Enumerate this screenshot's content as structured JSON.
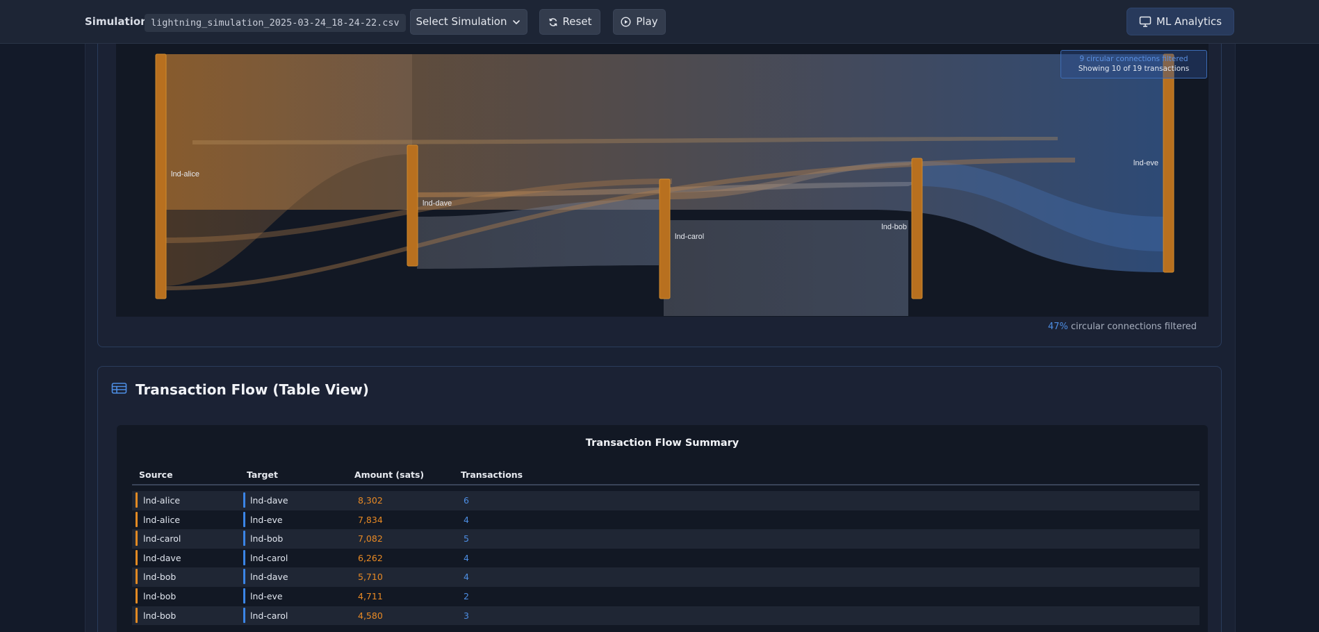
{
  "header": {
    "simulation_label": "Simulation:",
    "simulation_file": "lightning_simulation_2025-03-24_18-24-22.csv",
    "select_label": "Select Simulation",
    "reset_label": "Reset",
    "play_label": "Play",
    "ml_label": "ML Analytics"
  },
  "sankey": {
    "nodes": [
      {
        "id": "lnd-alice",
        "label": "lnd-alice"
      },
      {
        "id": "lnd-dave",
        "label": "lnd-dave"
      },
      {
        "id": "lnd-carol",
        "label": "lnd-carol"
      },
      {
        "id": "lnd-bob",
        "label": "lnd-bob"
      },
      {
        "id": "lnd-eve",
        "label": "lnd-eve"
      }
    ],
    "filter_line1": "9 circular connections filtered",
    "filter_line2": "Showing 10 of 19 transactions",
    "circular_pct": "47%",
    "circular_text": "circular connections filtered"
  },
  "table_section": {
    "title": "Transaction Flow (Table View)",
    "caption": "Transaction Flow Summary",
    "columns": [
      "Source",
      "Target",
      "Amount (sats)",
      "Transactions"
    ],
    "rows": [
      {
        "source": "lnd-alice",
        "target": "lnd-dave",
        "amount": "8,302",
        "transactions": "6"
      },
      {
        "source": "lnd-alice",
        "target": "lnd-eve",
        "amount": "7,834",
        "transactions": "4"
      },
      {
        "source": "lnd-carol",
        "target": "lnd-bob",
        "amount": "7,082",
        "transactions": "5"
      },
      {
        "source": "lnd-dave",
        "target": "lnd-carol",
        "amount": "6,262",
        "transactions": "4"
      },
      {
        "source": "lnd-bob",
        "target": "lnd-dave",
        "amount": "5,710",
        "transactions": "4"
      },
      {
        "source": "lnd-bob",
        "target": "lnd-eve",
        "amount": "4,711",
        "transactions": "2"
      },
      {
        "source": "lnd-bob",
        "target": "lnd-carol",
        "amount": "4,580",
        "transactions": "3"
      }
    ]
  },
  "colors": {
    "source": "#e28a23",
    "target": "#3b85e6",
    "background": "#131a29"
  }
}
